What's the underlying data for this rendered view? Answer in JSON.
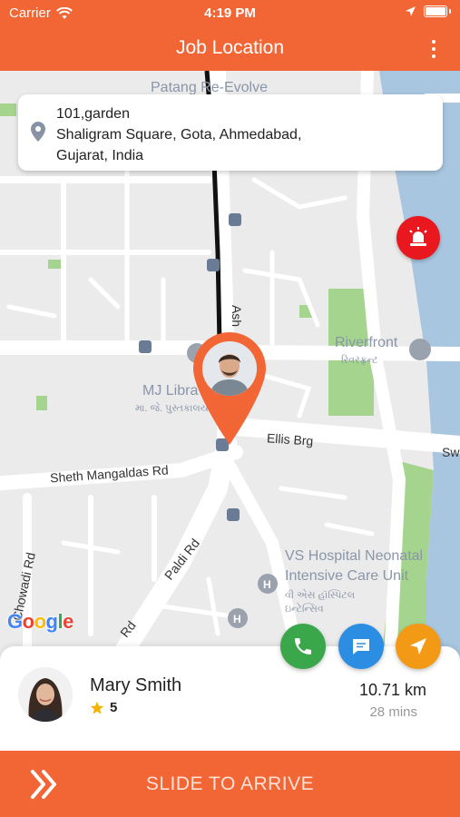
{
  "status_bar": {
    "carrier": "Carrier",
    "time": "4:19 PM"
  },
  "header": {
    "title": "Job Location"
  },
  "address": {
    "line1": "101,garden",
    "line2": "Shaligram Square, Gota, Ahmedabad,",
    "line3": "Gujarat, India"
  },
  "map": {
    "labels": {
      "patang": "Patang Re-Evolve",
      "riverfront": "Riverfront",
      "riverfront_gu": "રિવરફ્રન્ટ",
      "mj_library": "MJ Libra",
      "mj_library_gu": "મા. જે. પુસ્તકાલય",
      "ellis_brg": "Ellis Brg",
      "sheth_rd": "Sheth Mangaldas Rd",
      "paldi_rd": "Paldi Rd",
      "chowadi_rd": "Chowadi Rd",
      "rd": "Rd",
      "vs_hospital_1": "VS Hospital Neonatal",
      "vs_hospital_2": "Intensive Care Unit",
      "vs_hospital_gu1": "વી એસ હૉસ્પિટલ",
      "vs_hospital_gu2": "ઇન્ટેન્સિવ",
      "ash": "Ash",
      "sw": "Sw",
      "google": "Google"
    }
  },
  "customer": {
    "name": "Mary Smith",
    "rating": "5"
  },
  "trip": {
    "distance": "10.71 km",
    "duration": "28 mins"
  },
  "slide": {
    "label": "SLIDE TO ARRIVE"
  },
  "colors": {
    "primary": "#f26535",
    "sos": "#e8181e",
    "call": "#3aa74a",
    "chat": "#2c8ee3",
    "navigate": "#f29a16",
    "star": "#f5b400"
  }
}
